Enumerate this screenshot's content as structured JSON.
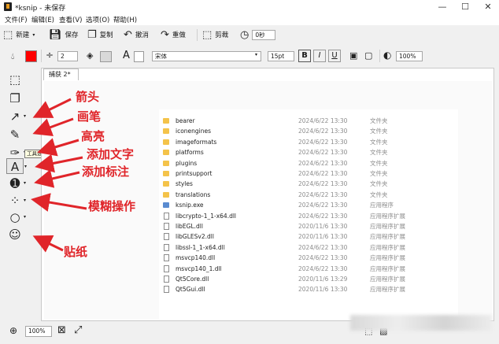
{
  "window": {
    "title": "*ksnip - 未保存",
    "controls": [
      "—",
      "☐",
      "✕"
    ]
  },
  "menu": [
    "文件(F)",
    "编辑(E)",
    "查看(V)",
    "选项(O)",
    "帮助(H)"
  ],
  "toolbar": {
    "new_label": "新建",
    "save_label": "保存",
    "copy_label": "复制",
    "undo_label": "撤消",
    "redo_label": "重做",
    "crop_label": "剪裁",
    "delay_value": "0秒"
  },
  "settings": {
    "stroke_width": "2",
    "font_name": "宋体",
    "font_size": "15pt",
    "zoom_value": "100%",
    "accent_color": "#ff0000"
  },
  "tab_label": "捕获 2*",
  "tooltip": "工具选择",
  "files": [
    {
      "name": "bearer",
      "date": "2024/6/22 13:30",
      "type": "文件夹",
      "icon": "folder"
    },
    {
      "name": "iconengines",
      "date": "2024/6/22 13:30",
      "type": "文件夹",
      "icon": "folder"
    },
    {
      "name": "imageformats",
      "date": "2024/6/22 13:30",
      "type": "文件夹",
      "icon": "folder"
    },
    {
      "name": "platforms",
      "date": "2024/6/22 13:30",
      "type": "文件夹",
      "icon": "folder"
    },
    {
      "name": "plugins",
      "date": "2024/6/22 13:30",
      "type": "文件夹",
      "icon": "folder"
    },
    {
      "name": "printsupport",
      "date": "2024/6/22 13:30",
      "type": "文件夹",
      "icon": "folder"
    },
    {
      "name": "styles",
      "date": "2024/6/22 13:30",
      "type": "文件夹",
      "icon": "folder"
    },
    {
      "name": "translations",
      "date": "2024/6/22 13:30",
      "type": "文件夹",
      "icon": "folder"
    },
    {
      "name": "ksnip.exe",
      "date": "2024/6/22 13:30",
      "type": "应用程序",
      "icon": "exe"
    },
    {
      "name": "libcrypto-1_1-x64.dll",
      "date": "2024/6/22 13:30",
      "type": "应用程序扩展",
      "icon": "doc"
    },
    {
      "name": "libEGL.dll",
      "date": "2020/11/6 13:30",
      "type": "应用程序扩展",
      "icon": "doc"
    },
    {
      "name": "libGLESv2.dll",
      "date": "2020/11/6 13:30",
      "type": "应用程序扩展",
      "icon": "doc"
    },
    {
      "name": "libssl-1_1-x64.dll",
      "date": "2024/6/22 13:30",
      "type": "应用程序扩展",
      "icon": "doc"
    },
    {
      "name": "msvcp140.dll",
      "date": "2024/6/22 13:30",
      "type": "应用程序扩展",
      "icon": "doc"
    },
    {
      "name": "msvcp140_1.dll",
      "date": "2024/6/22 13:30",
      "type": "应用程序扩展",
      "icon": "doc"
    },
    {
      "name": "Qt5Core.dll",
      "date": "2020/11/6 13:29",
      "type": "应用程序扩展",
      "icon": "doc"
    },
    {
      "name": "Qt5Gui.dll",
      "date": "2020/11/6 13:30",
      "type": "应用程序扩展",
      "icon": "doc"
    }
  ],
  "annotations": [
    "箭头",
    "画笔",
    "高亮",
    "添加文字",
    "添加标注",
    "模糊操作",
    "贴纸"
  ],
  "status": {
    "zoom_value": "100%"
  }
}
